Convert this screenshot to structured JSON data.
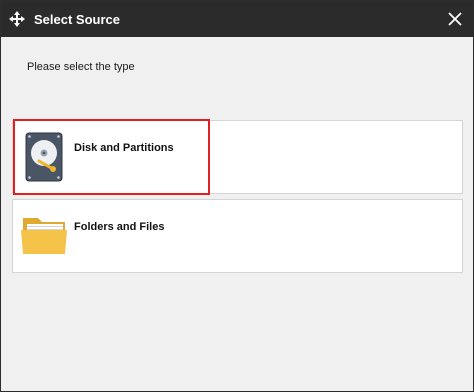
{
  "window": {
    "title": "Select Source",
    "title_icon": "sync-arrows-icon",
    "close_icon": "close-icon"
  },
  "prompt": "Please select the type",
  "options": [
    {
      "label": "Disk and Partitions",
      "icon": "hard-disk-icon",
      "selected": true
    },
    {
      "label": "Folders and Files",
      "icon": "folder-icon",
      "selected": false
    }
  ],
  "colors": {
    "titlebar": "#2b2b2b",
    "highlight": "#e02020",
    "folder": "#f5c24a"
  }
}
